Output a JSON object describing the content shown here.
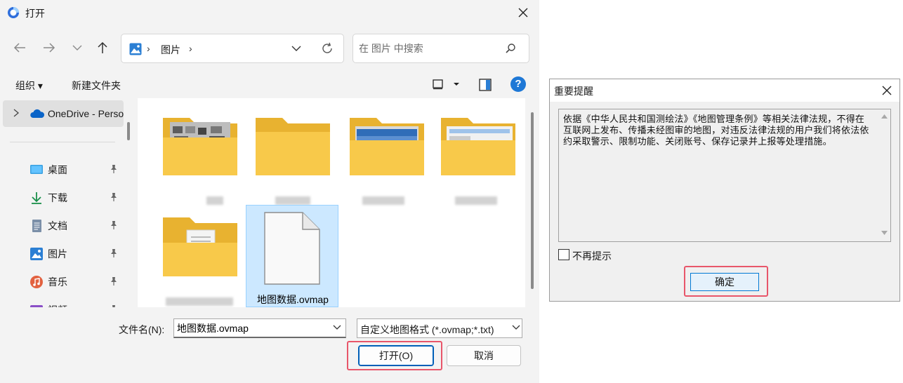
{
  "dialog": {
    "title": "打开",
    "address": {
      "crumb": "图片"
    },
    "search": {
      "placeholder": "在 图片 中搜索"
    },
    "commands": {
      "organize": "组织 ▾",
      "new_folder": "新建文件夹"
    },
    "help": "?",
    "nav": {
      "onedrive": "OneDrive - Personal",
      "quick_access": [
        {
          "label": "桌面",
          "icon": "desktop-icon"
        },
        {
          "label": "下载",
          "icon": "download-icon"
        },
        {
          "label": "文档",
          "icon": "document-icon"
        },
        {
          "label": "图片",
          "icon": "pictures-icon"
        },
        {
          "label": "音乐",
          "icon": "music-icon"
        },
        {
          "label": "视频",
          "icon": "video-icon"
        }
      ]
    },
    "files": [
      {
        "label": "",
        "icon": "folder-icon"
      },
      {
        "label": "",
        "icon": "folder-icon"
      },
      {
        "label": "",
        "icon": "folder-icon"
      },
      {
        "label": "",
        "icon": "folder-icon"
      },
      {
        "label": "",
        "icon": "folder-icon"
      },
      {
        "label": "地图数据.ovmap",
        "icon": "file-icon",
        "selected": true
      }
    ],
    "filename_label": "文件名(N):",
    "filename_value": "地图数据.ovmap",
    "filetype": "自定义地图格式 (*.ovmap;*.txt)",
    "open_button": "打开(O)",
    "cancel_button": "取消"
  },
  "alert": {
    "title": "重要提醒",
    "message": "依据《中华人民共和国测绘法》《地图管理条例》等相关法律法规，不得在互联网上发布、传播未经图审的地图，对违反法律法规的用户我们将依法依约采取警示、限制功能、关闭账号、保存记录并上报等处理措施。",
    "checkbox_label": "不再提示",
    "ok_button": "确定"
  },
  "colors": {
    "accent": "#005fb8",
    "highlight": "#e8566a",
    "folder": "#f8c94a",
    "selection": "#cce8ff"
  }
}
